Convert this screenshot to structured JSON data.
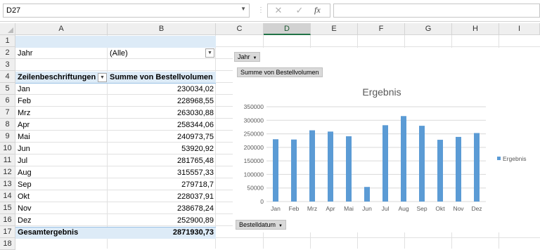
{
  "formula_bar": {
    "name_box": "D27",
    "formula": ""
  },
  "columns": [
    "A",
    "B",
    "C",
    "D",
    "E",
    "F",
    "G",
    "H",
    "I"
  ],
  "rows": [
    "1",
    "2",
    "3",
    "4",
    "5",
    "6",
    "7",
    "8",
    "9",
    "10",
    "11",
    "12",
    "13",
    "14",
    "15",
    "16",
    "17",
    "18"
  ],
  "selected_column": "D",
  "pivot": {
    "filter_label": "Jahr",
    "filter_value": "(Alle)",
    "row_header": "Zeilenbeschriftungen",
    "value_header": "Summe von Bestellvolumen",
    "rows": [
      {
        "label": "Jan",
        "value": "230034,02"
      },
      {
        "label": "Feb",
        "value": "228968,55"
      },
      {
        "label": "Mrz",
        "value": "263030,88"
      },
      {
        "label": "Apr",
        "value": "258344,06"
      },
      {
        "label": "Mai",
        "value": "240973,75"
      },
      {
        "label": "Jun",
        "value": "53920,92"
      },
      {
        "label": "Jul",
        "value": "281765,48"
      },
      {
        "label": "Aug",
        "value": "315557,33"
      },
      {
        "label": "Sep",
        "value": "279718,7"
      },
      {
        "label": "Okt",
        "value": "228037,91"
      },
      {
        "label": "Nov",
        "value": "238678,24"
      },
      {
        "label": "Dez",
        "value": "252900,89"
      }
    ],
    "total_label": "Gesamtergebnis",
    "total_value": "2871930,73"
  },
  "chart_buttons": {
    "filter": "Jahr",
    "value": "Summe  von Bestellvolumen",
    "axis": "Bestelldatum"
  },
  "chart_data": {
    "type": "bar",
    "title": "Ergebnis",
    "categories": [
      "Jan",
      "Feb",
      "Mrz",
      "Apr",
      "Mai",
      "Jun",
      "Jul",
      "Aug",
      "Sep",
      "Okt",
      "Nov",
      "Dez"
    ],
    "series": [
      {
        "name": "Ergebnis",
        "values": [
          230034.02,
          228968.55,
          263030.88,
          258344.06,
          240973.75,
          53920.92,
          281765.48,
          315557.33,
          279718.7,
          228037.91,
          238678.24,
          252900.89
        ],
        "color": "#5b9bd5"
      }
    ],
    "yticks": [
      "0",
      "50000",
      "100000",
      "150000",
      "200000",
      "250000",
      "300000",
      "350000"
    ],
    "ylim": [
      0,
      350000
    ],
    "grid": true,
    "legend": "right"
  }
}
